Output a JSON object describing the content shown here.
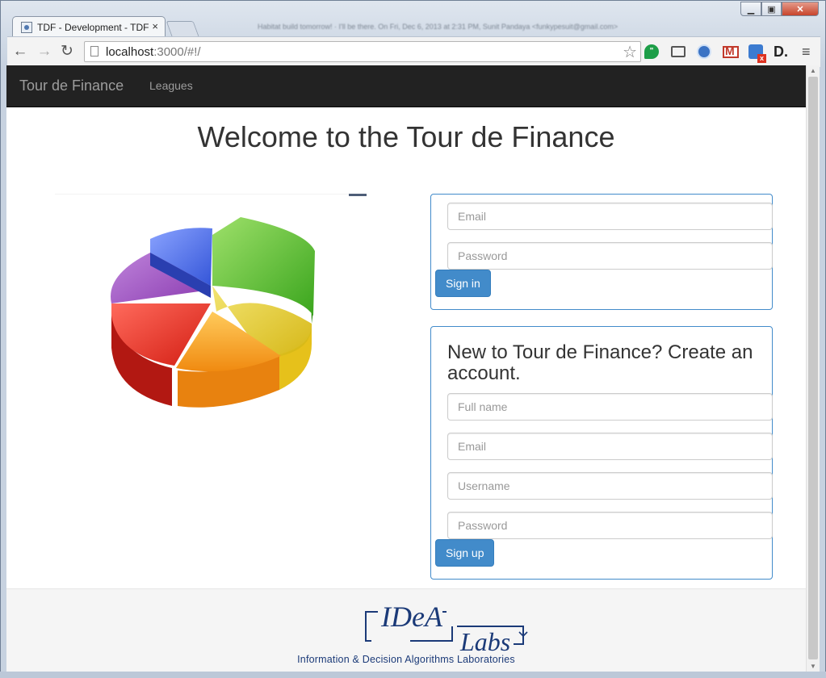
{
  "browser": {
    "tab_title": "TDF - Development - TDF",
    "tab_close": "×",
    "background_text": "Habitat build tomorrow! · I'll be there. On Fri, Dec 6, 2013 at 2:31 PM, Sunit Pandaya <funkypesuit@gmail.com>",
    "url_host": "localhost",
    "url_rest": ":3000/#!/",
    "back_icon": "←",
    "forward_icon": "→",
    "reload_icon": "↻",
    "star_icon": "☆",
    "menu_icon": "≡",
    "min_label": "▁",
    "max_label": "▣",
    "close_label": "✕",
    "extensions": [
      "hangouts-icon",
      "cast-icon",
      "phone-icon",
      "gmail-icon",
      "rss-icon",
      "d-icon"
    ]
  },
  "navbar": {
    "brand": "Tour de Finance",
    "links": [
      "Leagues"
    ]
  },
  "main": {
    "title": "Welcome to the Tour de Finance"
  },
  "signin": {
    "email_placeholder": "Email",
    "password_placeholder": "Password",
    "button": "Sign in"
  },
  "signup": {
    "heading": "New to Tour de Finance? Create an account.",
    "fullname_placeholder": "Full name",
    "email_placeholder": "Email",
    "username_placeholder": "Username",
    "password_placeholder": "Password",
    "button": "Sign up"
  },
  "footer": {
    "logo_text_top": "IDeA",
    "logo_text_bottom": "Labs",
    "caption": "Information & Decision Algorithms Laboratories"
  },
  "colors": {
    "navbar_bg": "#222222",
    "primary": "#428bca",
    "logo_blue": "#1b3a78"
  }
}
